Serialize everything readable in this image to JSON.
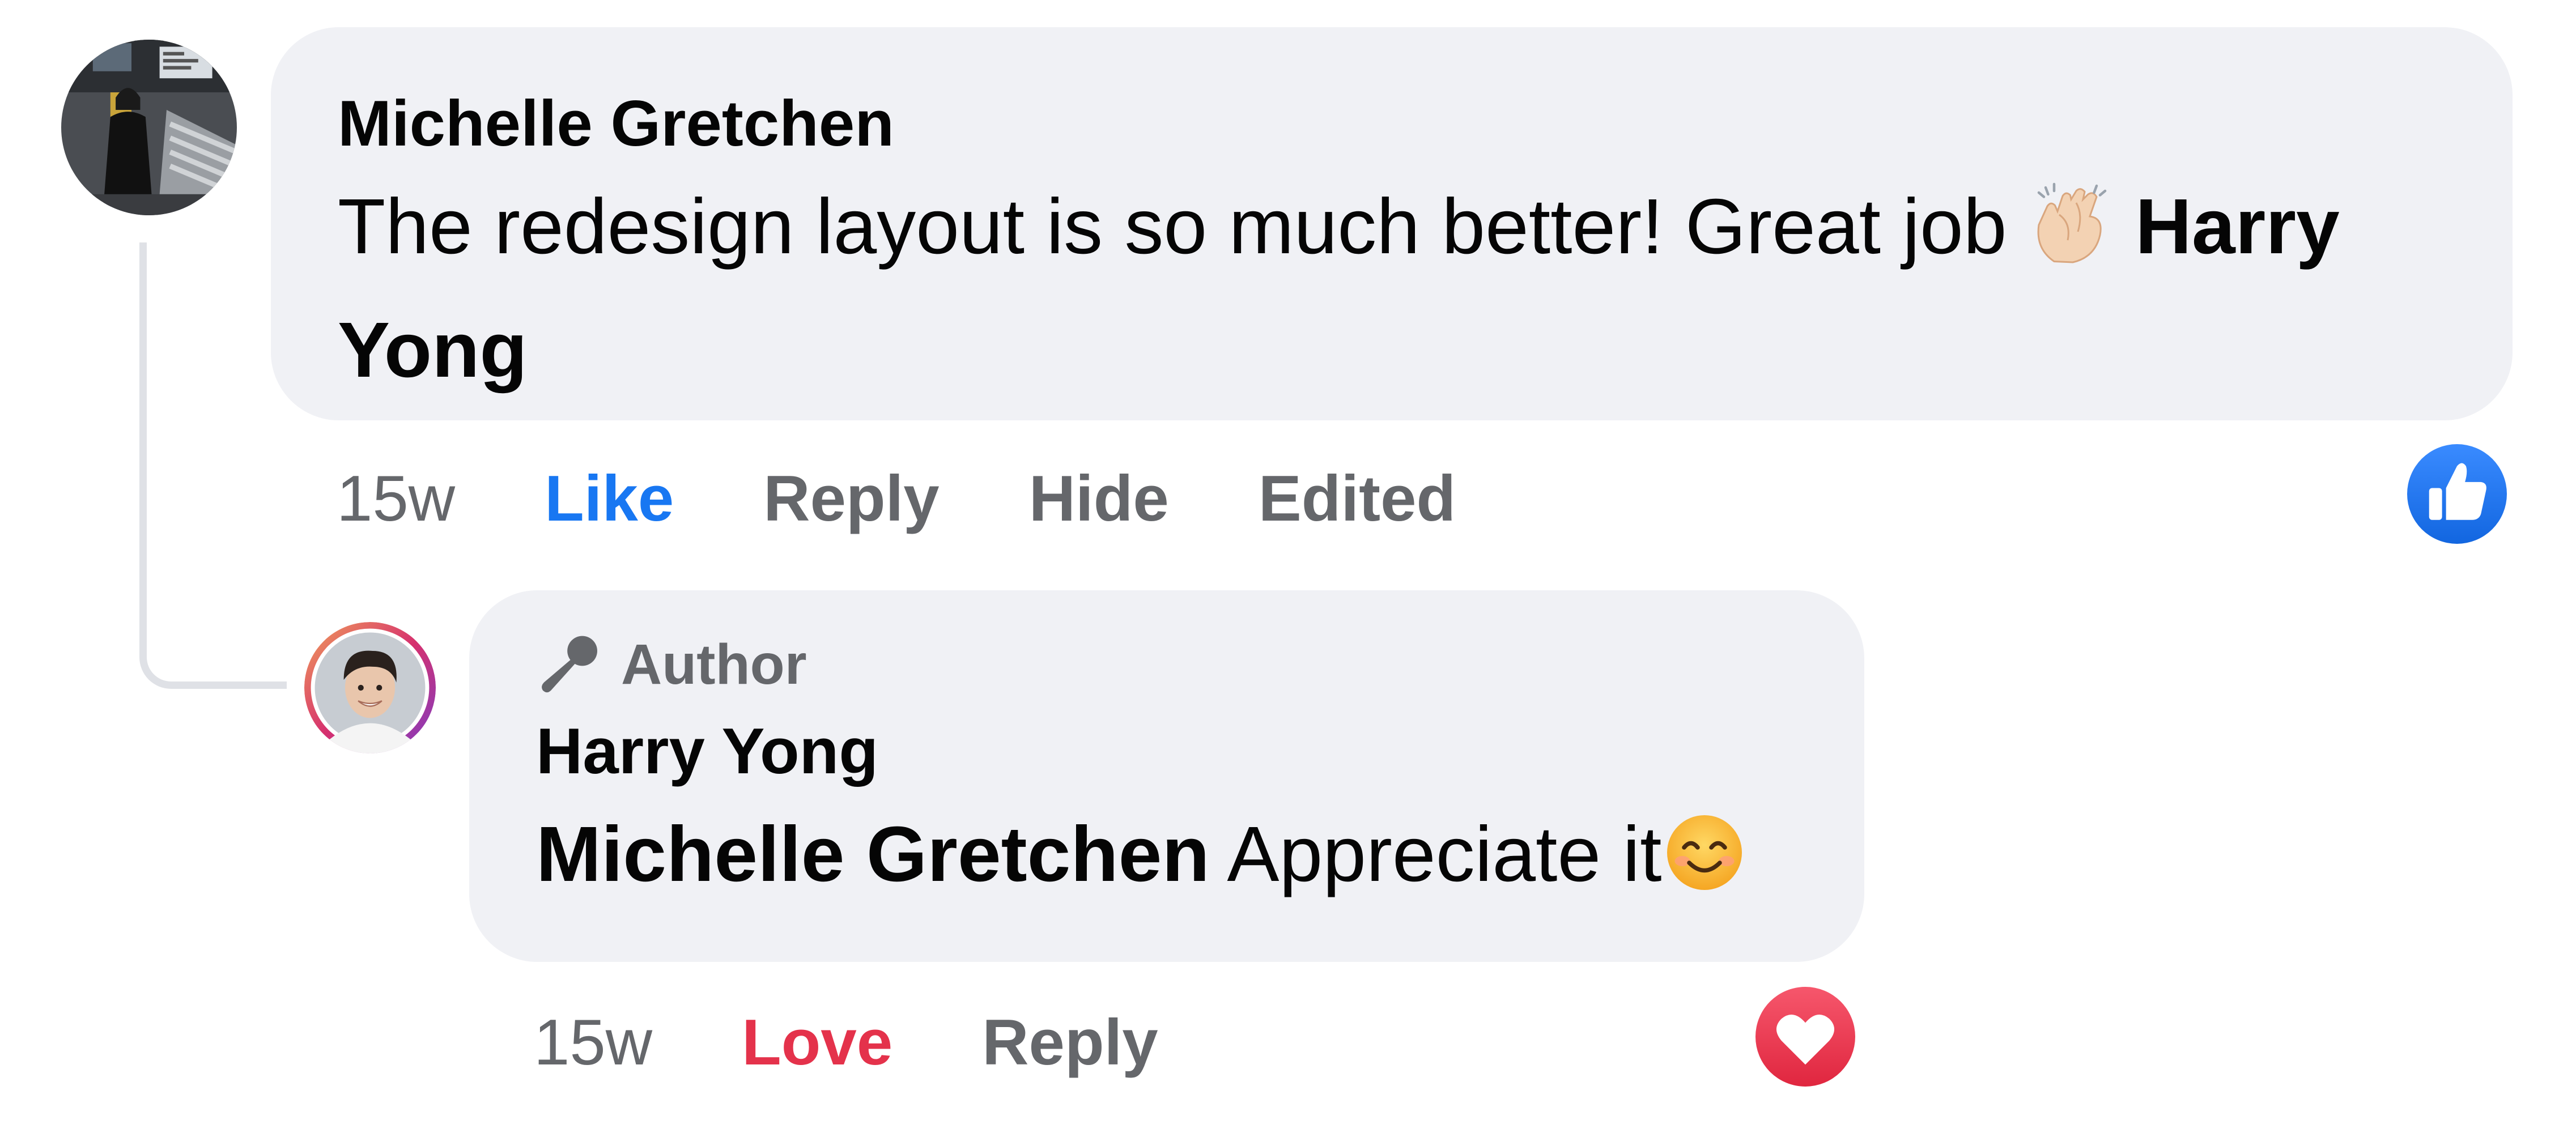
{
  "comment": {
    "author": "Michelle Gretchen",
    "text": "The redesign layout is so much better! Great job ",
    "emoji_name": "clapping-hands",
    "mention": "Harry Yong",
    "actions": {
      "time": "15w",
      "like": "Like",
      "reply": "Reply",
      "hide": "Hide",
      "edited": "Edited"
    },
    "reaction": "like-icon"
  },
  "reply": {
    "badge": "Author",
    "badge_icon": "microphone-icon",
    "author": "Harry Yong",
    "mention": "Michelle Gretchen",
    "text": " Appreciate it",
    "emoji_name": "smiling-face",
    "actions": {
      "time": "15w",
      "love": "Love",
      "reply": "Reply"
    },
    "reaction": "love-icon"
  },
  "colors": {
    "bubble": "#f0f1f5",
    "secondary_text": "#65676b",
    "like_blue": "#1877f2",
    "love_red": "#e4324b",
    "thread_line": "#dfe1e6"
  }
}
